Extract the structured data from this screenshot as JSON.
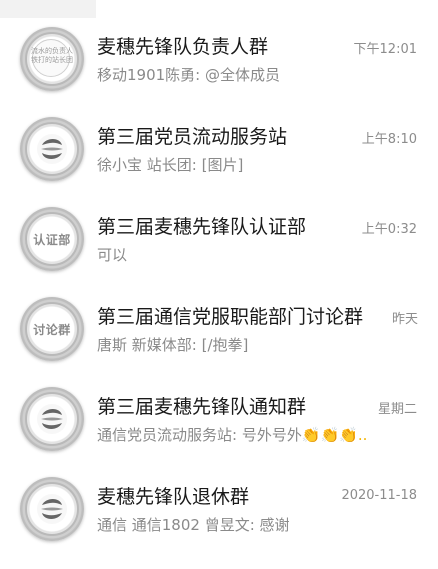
{
  "chats": [
    {
      "title": "麦穗先锋队负责人群",
      "time": "下午12:01",
      "preview": "移动1901陈勇: @全体成员",
      "avatar": {
        "kind": "seal-text",
        "text": "流水的负责人 铁打的站长团"
      }
    },
    {
      "title": "第三届党员流动服务站",
      "time": "上午8:10",
      "preview": "徐小宝  站长团: [图片]",
      "avatar": {
        "kind": "seal-logo"
      }
    },
    {
      "title": "第三届麦穗先锋队认证部",
      "time": "上午0:32",
      "preview": "可以",
      "avatar": {
        "kind": "seal-label",
        "text": "认证部"
      }
    },
    {
      "title": "第三届通信党服职能部门讨论群",
      "time": "昨天",
      "preview": "唐斯  新媒体部: [/抱拳]",
      "avatar": {
        "kind": "seal-label",
        "text": "讨论群"
      }
    },
    {
      "title": "第三届麦穗先锋队通知群",
      "time": "星期二",
      "preview": "通信党员流动服务站: 号外号外",
      "preview_emoji": "👏👏👏...",
      "avatar": {
        "kind": "seal-logo"
      }
    },
    {
      "title": "麦穗先锋队退休群",
      "time": "2020-11-18",
      "preview": "通信  通信1802 曾昱文: 感谢",
      "avatar": {
        "kind": "seal-logo"
      }
    }
  ]
}
